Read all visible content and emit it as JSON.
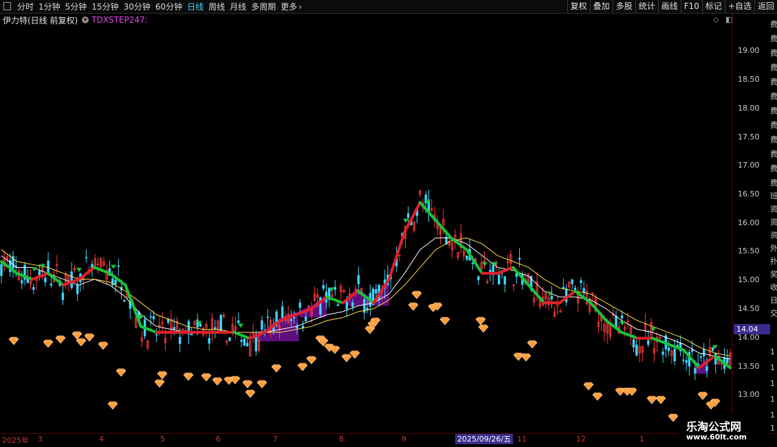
{
  "toolbar": {
    "periods": [
      "分时",
      "1分钟",
      "5分钟",
      "15分钟",
      "30分钟",
      "60分钟",
      "日线",
      "周线",
      "月线",
      "多周期",
      "更多"
    ],
    "active": "日线",
    "buttons": [
      "复权",
      "叠加",
      "多股",
      "统计",
      "画线",
      "F10",
      "标记",
      "+自选",
      "返回"
    ]
  },
  "subtitle": {
    "stock": "伊力特(日线 前复权)",
    "indicator": "TDXSTEP247:"
  },
  "price_axis": {
    "labels": [
      "19.00",
      "18.50",
      "18.00",
      "17.50",
      "17.00",
      "16.50",
      "16.00",
      "15.50",
      "15.00",
      "14.50",
      "14.00",
      "13.50",
      "13.00"
    ],
    "current_price": "14.04"
  },
  "right_strip": [
    "费",
    "费",
    "费",
    "费",
    "费",
    "费",
    "费",
    "费",
    "费",
    "费",
    "费",
    "费",
    "班",
    "资",
    "资",
    "资",
    "外",
    "扑",
    "奖",
    "收",
    "日",
    "交",
    "1",
    "1",
    "1",
    "1",
    "1",
    "1"
  ],
  "time_axis": {
    "labels": [
      "2025年",
      "3",
      "4",
      "5",
      "6",
      "7",
      "8",
      "9",
      "11",
      "12",
      "1"
    ],
    "cursor": "2025/09/26/五"
  },
  "watermark": {
    "name": "乐淘公式网",
    "url": "www.60lt.com"
  },
  "colors": {
    "up": "#ff3b3b",
    "down": "#3fd6ff",
    "step_red": "#e0202a",
    "step_green": "#17c43a",
    "fill": "#6a0f8c",
    "ma_white": "#ffffff",
    "ma_yellow": "#ffe24a",
    "diamond": "#ff9a33"
  },
  "chart_data": {
    "type": "candlestick",
    "ylim": [
      12.8,
      19.5
    ],
    "icons": [
      "diamond-icon",
      "up-arrow-icon",
      "down-arrow-icon"
    ],
    "series": [
      {
        "name": "",
        "values": [
          15.5,
          15.3,
          15.2,
          15.3,
          15.1,
          15.2,
          15.4,
          15.3,
          15.1,
          14.4,
          14.3,
          14.3,
          14.3,
          14.3,
          14.3,
          14.3,
          14.2,
          14.3,
          14.5,
          14.6,
          14.7,
          14.9,
          14.8,
          15.0,
          14.8,
          15.2,
          16.0,
          16.5,
          16.2,
          15.9,
          15.7,
          15.3,
          15.3,
          15.4,
          15.1,
          14.8,
          14.8,
          15.0,
          14.8,
          14.5,
          14.3,
          14.2,
          14.2,
          14.1,
          14.0,
          13.7,
          13.9,
          13.7
        ]
      },
      {
        "name": "",
        "values": [
          15.6,
          15.4,
          15.4,
          15.3,
          15.2,
          15.1,
          15.2,
          15.1,
          14.9,
          14.6,
          14.4,
          14.35,
          14.3,
          14.3,
          14.3,
          14.3,
          14.3,
          14.3,
          14.35,
          14.4,
          14.5,
          14.6,
          14.65,
          14.75,
          14.8,
          14.95,
          15.3,
          15.7,
          15.9,
          15.9,
          15.8,
          15.6,
          15.4,
          15.35,
          15.25,
          15.0,
          14.9,
          14.9,
          14.85,
          14.7,
          14.5,
          14.35,
          14.3,
          14.2,
          14.1,
          13.95,
          13.9,
          13.85
        ]
      },
      {
        "name": "",
        "values": [
          15.7,
          15.5,
          15.45,
          15.4,
          15.3,
          15.2,
          15.2,
          15.15,
          15.0,
          14.8,
          14.6,
          14.5,
          14.4,
          14.35,
          14.35,
          14.3,
          14.3,
          14.3,
          14.3,
          14.35,
          14.4,
          14.5,
          14.55,
          14.65,
          14.7,
          14.85,
          15.1,
          15.4,
          15.7,
          15.85,
          15.9,
          15.8,
          15.6,
          15.5,
          15.4,
          15.2,
          15.05,
          15.0,
          14.95,
          14.8,
          14.65,
          14.5,
          14.4,
          14.3,
          14.2,
          14.05,
          13.95,
          13.9
        ]
      }
    ]
  }
}
